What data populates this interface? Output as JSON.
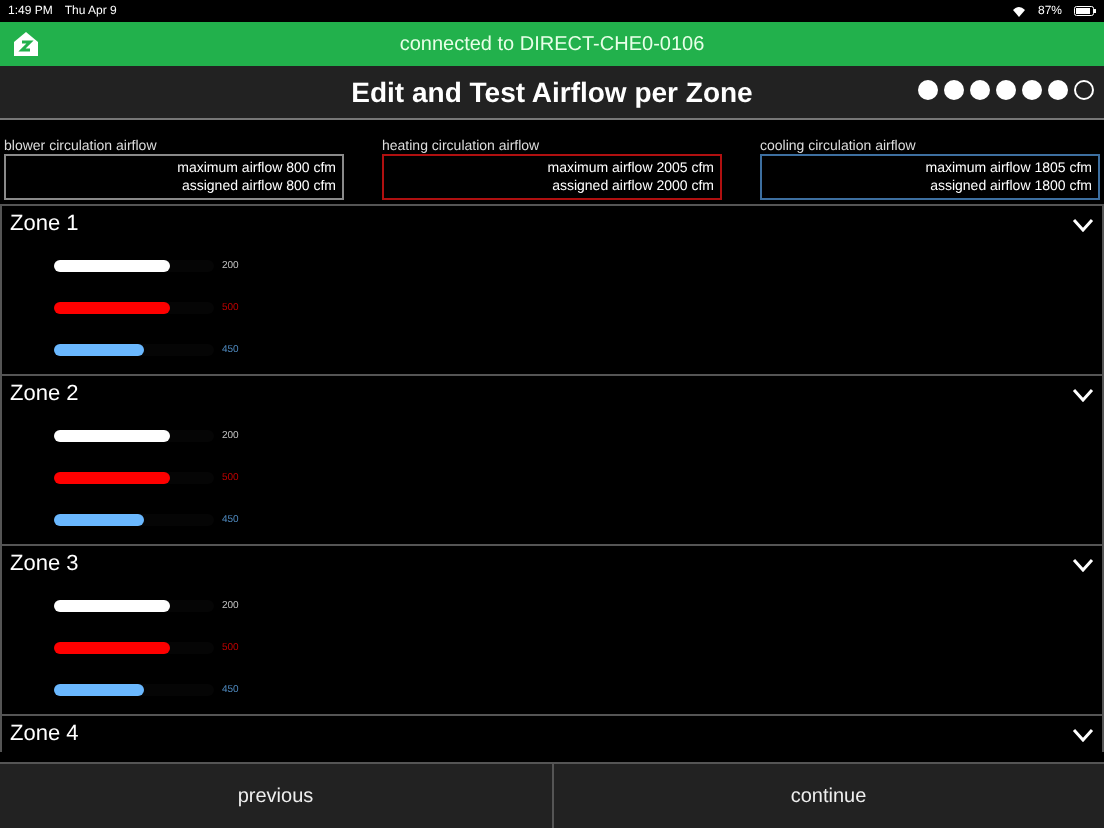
{
  "status_bar": {
    "time": "1:49 PM",
    "date": "Thu Apr 9",
    "battery": "87%"
  },
  "connection_bar": {
    "text": "connected to DIRECT-CHE0-0106"
  },
  "header": {
    "title": "Edit and Test Airflow per Zone",
    "steps": [
      {
        "done": true
      },
      {
        "done": true
      },
      {
        "done": true
      },
      {
        "done": true
      },
      {
        "done": true
      },
      {
        "done": true
      },
      {
        "done": false
      }
    ]
  },
  "summaries": [
    {
      "label": "blower circulation airflow",
      "color": "#8a8a8a",
      "maximum": "maximum airflow 800 cfm",
      "assigned": "assigned airflow 800 cfm"
    },
    {
      "label": "heating circulation airflow",
      "color": "#b01010",
      "maximum": "maximum airflow 2005 cfm",
      "assigned": "assigned airflow 2000 cfm"
    },
    {
      "label": "cooling circulation airflow",
      "color": "#3d6fa0",
      "maximum": "maximum airflow 1805 cfm",
      "assigned": "assigned airflow 1800 cfm"
    }
  ],
  "zones": [
    {
      "name": "Zone 1",
      "bars": [
        {
          "color": "#ffffff",
          "level": 0.72,
          "value": "200"
        },
        {
          "color": "#ff0000",
          "level": 0.72,
          "value": "500"
        },
        {
          "color": "#6ab8ff",
          "level": 0.56,
          "value": "450"
        }
      ]
    },
    {
      "name": "Zone 2",
      "bars": [
        {
          "color": "#ffffff",
          "level": 0.72,
          "value": "200"
        },
        {
          "color": "#ff0000",
          "level": 0.72,
          "value": "500"
        },
        {
          "color": "#6ab8ff",
          "level": 0.56,
          "value": "450"
        }
      ]
    },
    {
      "name": "Zone 3",
      "bars": [
        {
          "color": "#ffffff",
          "level": 0.72,
          "value": "200"
        },
        {
          "color": "#ff0000",
          "level": 0.72,
          "value": "500"
        },
        {
          "color": "#6ab8ff",
          "level": 0.56,
          "value": "450"
        }
      ]
    },
    {
      "name": "Zone 4"
    }
  ],
  "footer": {
    "buttons": [
      "previous",
      "continue"
    ]
  }
}
